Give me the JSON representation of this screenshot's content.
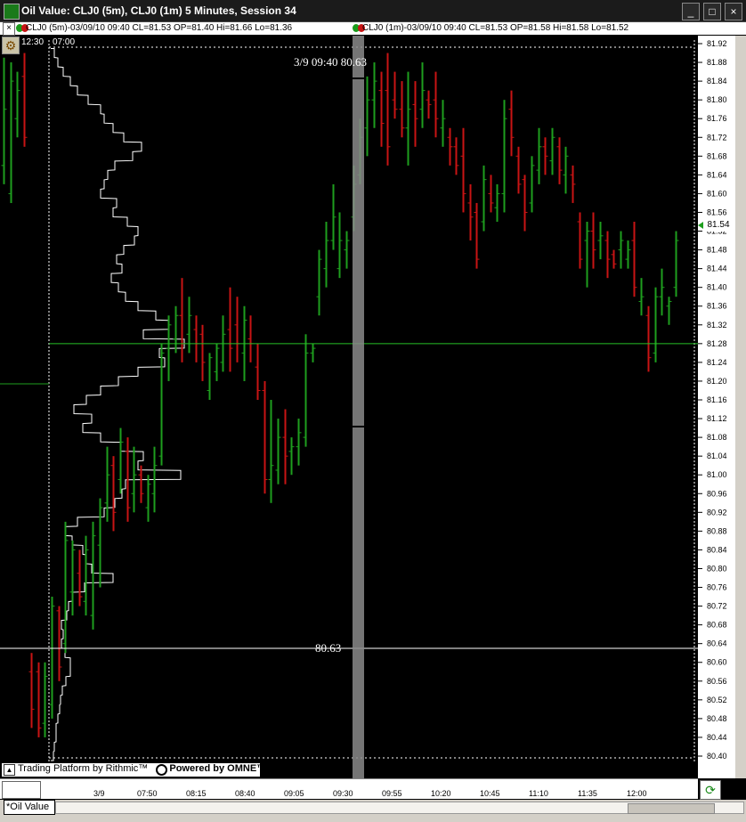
{
  "window": {
    "title": "Oil Value: CLJ0 (5m), CLJ0 (1m) 5 Minutes, Session 34",
    "controls": [
      "_",
      "□",
      "×"
    ]
  },
  "legend": {
    "close_label": "×",
    "series1": "CLJ0 (5m)-03/09/10 09:40 CL=81.53 OP=81.40 Hi=81.66 Lo=81.36",
    "series2": "CLJ0 (1m)-03/09/10 09:40 CL=81.53 OP=81.58 Hi=81.58 Lo=81.52"
  },
  "session_labels": {
    "left": "12:30",
    "right": "07:00"
  },
  "crosshair_label": "3/9 09:40 80.63",
  "hline_label": "80.63",
  "last_price": "81.54",
  "watermark": {
    "left": "Trading Platform by Rithmic™",
    "right": "Powered by OMNE™"
  },
  "xaxis_labels": [
    "3/9",
    "07:50",
    "08:15",
    "08:40",
    "09:05",
    "09:30",
    "09:55",
    "10:20",
    "10:45",
    "11:10",
    "11:35",
    "12:00"
  ],
  "tab": {
    "label": "*Oil Value"
  },
  "colors": {
    "up": "#1e9e1e",
    "down": "#c81414",
    "profile": "#ffffff",
    "hline_green": "#26c026",
    "hline_white": "#ffffff",
    "background": "#000000"
  },
  "chart_data": {
    "type": "bar",
    "y_ticks": [
      "81.92",
      "81.88",
      "81.84",
      "81.80",
      "81.76",
      "81.72",
      "81.68",
      "81.64",
      "81.60",
      "81.56",
      "81.52",
      "81.48",
      "81.44",
      "81.40",
      "81.36",
      "81.32",
      "81.28",
      "81.24",
      "81.20",
      "81.16",
      "81.12",
      "81.08",
      "81.04",
      "81.00",
      "80.96",
      "80.92",
      "80.88",
      "80.84",
      "80.80",
      "80.76",
      "80.72",
      "80.68",
      "80.64",
      "80.60",
      "80.56",
      "80.52",
      "80.48",
      "80.44",
      "80.40"
    ],
    "ylim": [
      80.38,
      81.94
    ],
    "reference_lines": [
      81.28,
      80.63
    ],
    "bars": [
      [
        81.89,
        81.62,
        81.66,
        81.78
      ],
      [
        81.88,
        81.58,
        81.6,
        81.84
      ],
      [
        81.86,
        81.72,
        81.76,
        81.82
      ],
      [
        81.9,
        81.7,
        81.85,
        81.72
      ],
      [
        80.62,
        80.46,
        80.58,
        80.5
      ],
      [
        80.6,
        80.44,
        80.58,
        80.46
      ],
      [
        80.6,
        80.44,
        80.47,
        80.57
      ],
      [
        80.74,
        80.48,
        80.51,
        80.72
      ],
      [
        80.72,
        80.56,
        80.71,
        80.59
      ],
      [
        80.9,
        80.62,
        80.64,
        80.86
      ],
      [
        80.86,
        80.7,
        80.75,
        80.84
      ],
      [
        80.84,
        80.72,
        80.79,
        80.74
      ],
      [
        80.87,
        80.7,
        80.73,
        80.84
      ],
      [
        80.9,
        80.67,
        80.7,
        80.87
      ],
      [
        80.95,
        80.76,
        80.85,
        80.93
      ],
      [
        81.06,
        80.9,
        80.94,
        81.0
      ],
      [
        81.04,
        80.88,
        81.02,
        80.92
      ],
      [
        81.1,
        80.96,
        80.99,
        81.07
      ],
      [
        81.08,
        80.9,
        81.05,
        80.93
      ],
      [
        81.06,
        80.92,
        80.96,
        81.0
      ],
      [
        81.02,
        80.94,
        81.0,
        80.96
      ],
      [
        81.0,
        80.9,
        80.93,
        80.98
      ],
      [
        81.06,
        80.92,
        80.96,
        81.02
      ],
      [
        81.28,
        81.02,
        81.04,
        81.26
      ],
      [
        81.34,
        81.2,
        81.27,
        81.32
      ],
      [
        81.36,
        81.26,
        81.29,
        81.34
      ],
      [
        81.42,
        81.24,
        81.34,
        81.28
      ],
      [
        81.38,
        81.26,
        81.3,
        81.34
      ],
      [
        81.34,
        81.24,
        81.31,
        81.28
      ],
      [
        81.32,
        81.2,
        81.3,
        81.24
      ],
      [
        81.26,
        81.16,
        81.18,
        81.25
      ],
      [
        81.28,
        81.2,
        81.22,
        81.27
      ],
      [
        81.34,
        81.22,
        81.24,
        81.3
      ],
      [
        81.4,
        81.22,
        81.31,
        81.27
      ],
      [
        81.38,
        81.24,
        81.32,
        81.28
      ],
      [
        81.36,
        81.2,
        81.26,
        81.33
      ],
      [
        81.34,
        81.24,
        81.29,
        81.28
      ],
      [
        81.28,
        81.16,
        81.23,
        81.18
      ],
      [
        81.2,
        80.96,
        81.18,
        80.99
      ],
      [
        81.16,
        80.94,
        80.99,
        81.02
      ],
      [
        81.12,
        80.98,
        81.01,
        81.08
      ],
      [
        81.14,
        80.98,
        81.08,
        81.04
      ],
      [
        81.08,
        81.0,
        81.05,
        81.06
      ],
      [
        81.12,
        81.02,
        81.06,
        81.09
      ],
      [
        81.3,
        81.06,
        81.08,
        81.26
      ],
      [
        81.28,
        81.24,
        81.26,
        81.27
      ],
      [
        81.48,
        81.34,
        81.38,
        81.46
      ],
      [
        81.54,
        81.4,
        81.44,
        81.5
      ],
      [
        81.62,
        81.48,
        81.5,
        81.55
      ],
      [
        81.56,
        81.42,
        81.44,
        81.5
      ],
      [
        81.52,
        81.44,
        81.48,
        81.5
      ],
      [
        81.66,
        81.52,
        81.55,
        81.62
      ],
      [
        81.76,
        81.62,
        81.64,
        81.72
      ],
      [
        81.85,
        81.68,
        81.74,
        81.8
      ],
      [
        81.88,
        81.74,
        81.8,
        81.84
      ],
      [
        81.86,
        81.7,
        81.82,
        81.75
      ],
      [
        81.9,
        81.66,
        81.82,
        81.7
      ],
      [
        81.86,
        81.76,
        81.8,
        81.78
      ],
      [
        81.84,
        81.72,
        81.78,
        81.74
      ],
      [
        81.86,
        81.66,
        81.74,
        81.78
      ],
      [
        81.84,
        81.7,
        81.79,
        81.76
      ],
      [
        81.88,
        81.74,
        81.78,
        81.82
      ],
      [
        81.82,
        81.76,
        81.8,
        81.79
      ],
      [
        81.86,
        81.72,
        81.8,
        81.76
      ],
      [
        81.8,
        81.7,
        81.74,
        81.76
      ],
      [
        81.74,
        81.66,
        81.72,
        81.7
      ],
      [
        81.72,
        81.64,
        81.7,
        81.66
      ],
      [
        81.74,
        81.56,
        81.68,
        81.6
      ],
      [
        81.62,
        81.5,
        81.58,
        81.55
      ],
      [
        81.58,
        81.44,
        81.56,
        81.46
      ],
      [
        81.66,
        81.52,
        81.54,
        81.63
      ],
      [
        81.64,
        81.56,
        81.6,
        81.58
      ],
      [
        81.62,
        81.54,
        81.57,
        81.6
      ],
      [
        81.8,
        81.56,
        81.6,
        81.76
      ],
      [
        81.82,
        81.68,
        81.78,
        81.72
      ],
      [
        81.7,
        81.6,
        81.68,
        81.62
      ],
      [
        81.64,
        81.52,
        81.63,
        81.56
      ],
      [
        81.68,
        81.56,
        81.58,
        81.66
      ],
      [
        81.74,
        81.62,
        81.65,
        81.7
      ],
      [
        81.72,
        81.64,
        81.7,
        81.68
      ],
      [
        81.74,
        81.64,
        81.67,
        81.72
      ],
      [
        81.72,
        81.62,
        81.7,
        81.65
      ],
      [
        81.7,
        81.6,
        81.64,
        81.68
      ],
      [
        81.66,
        81.58,
        81.64,
        81.62
      ],
      [
        81.56,
        81.44,
        81.54,
        81.46
      ],
      [
        81.54,
        81.4,
        81.5,
        81.52
      ],
      [
        81.56,
        81.44,
        81.52,
        81.48
      ],
      [
        81.54,
        81.46,
        81.5,
        81.51
      ],
      [
        81.52,
        81.42,
        81.5,
        81.46
      ],
      [
        81.48,
        81.44,
        81.47,
        81.45
      ],
      [
        81.52,
        81.44,
        81.48,
        81.5
      ],
      [
        81.5,
        81.44,
        81.46,
        81.48
      ],
      [
        81.54,
        81.38,
        81.5,
        81.4
      ],
      [
        81.42,
        81.34,
        81.37,
        81.38
      ],
      [
        81.36,
        81.22,
        81.34,
        81.25
      ],
      [
        81.4,
        81.24,
        81.26,
        81.38
      ],
      [
        81.44,
        81.34,
        81.38,
        81.4
      ],
      [
        81.38,
        81.32,
        81.36,
        81.37
      ],
      [
        81.52,
        81.38,
        81.4,
        81.5
      ]
    ],
    "profile": [
      [
        80.4,
        3
      ],
      [
        80.42,
        4
      ],
      [
        80.44,
        6
      ],
      [
        80.46,
        6
      ],
      [
        80.48,
        8
      ],
      [
        80.5,
        10
      ],
      [
        80.52,
        11
      ],
      [
        80.54,
        13
      ],
      [
        80.56,
        17
      ],
      [
        80.58,
        22
      ],
      [
        80.6,
        22
      ],
      [
        80.62,
        16
      ],
      [
        80.64,
        12
      ],
      [
        80.66,
        14
      ],
      [
        80.68,
        12
      ],
      [
        80.7,
        18
      ],
      [
        80.72,
        20
      ],
      [
        80.74,
        24
      ],
      [
        80.76,
        38
      ],
      [
        80.78,
        70
      ],
      [
        80.8,
        46
      ],
      [
        80.82,
        40
      ],
      [
        80.84,
        36
      ],
      [
        80.86,
        24
      ],
      [
        80.88,
        16
      ],
      [
        80.9,
        30
      ],
      [
        80.92,
        60
      ],
      [
        80.94,
        72
      ],
      [
        80.96,
        80
      ],
      [
        80.98,
        84
      ],
      [
        81.0,
        146
      ],
      [
        81.02,
        98
      ],
      [
        81.04,
        104
      ],
      [
        81.06,
        78
      ],
      [
        81.08,
        56
      ],
      [
        81.1,
        36
      ],
      [
        81.12,
        46
      ],
      [
        81.14,
        26
      ],
      [
        81.16,
        40
      ],
      [
        81.18,
        56
      ],
      [
        81.2,
        76
      ],
      [
        81.22,
        98
      ],
      [
        81.24,
        128
      ],
      [
        81.26,
        122
      ],
      [
        81.28,
        150
      ],
      [
        81.3,
        104
      ],
      [
        81.32,
        132
      ],
      [
        81.34,
        118
      ],
      [
        81.36,
        98
      ],
      [
        81.38,
        84
      ],
      [
        81.4,
        76
      ],
      [
        81.42,
        68
      ],
      [
        81.44,
        80
      ],
      [
        81.46,
        74
      ],
      [
        81.48,
        82
      ],
      [
        81.5,
        94
      ],
      [
        81.52,
        98
      ],
      [
        81.54,
        86
      ],
      [
        81.56,
        70
      ],
      [
        81.58,
        74
      ],
      [
        81.6,
        56
      ],
      [
        81.62,
        60
      ],
      [
        81.64,
        64
      ],
      [
        81.66,
        72
      ],
      [
        81.68,
        92
      ],
      [
        81.7,
        102
      ],
      [
        81.72,
        82
      ],
      [
        81.74,
        70
      ],
      [
        81.76,
        60
      ],
      [
        81.78,
        56
      ],
      [
        81.8,
        42
      ],
      [
        81.82,
        30
      ],
      [
        81.84,
        22
      ],
      [
        81.86,
        14
      ],
      [
        81.88,
        8
      ],
      [
        81.9,
        4
      ]
    ]
  }
}
